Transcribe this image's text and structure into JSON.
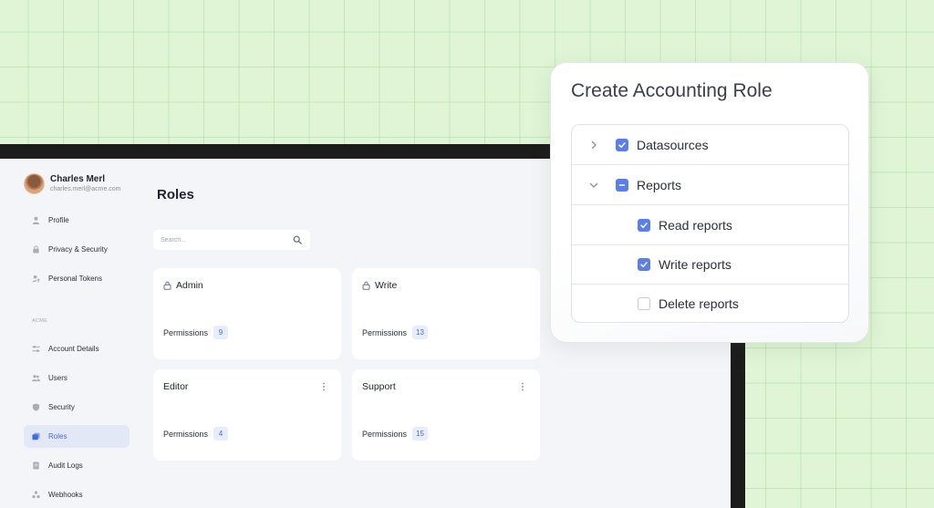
{
  "user": {
    "name": "Charles Merl",
    "email": "charles.merl@acme.com"
  },
  "sidebar": {
    "items": [
      {
        "label": "Profile",
        "icon": "user-icon"
      },
      {
        "label": "Privacy & Security",
        "icon": "lock-icon"
      },
      {
        "label": "Personal Tokens",
        "icon": "user-key-icon"
      }
    ],
    "section_label": "ACME",
    "org_items": [
      {
        "label": "Account Details",
        "icon": "sliders-icon"
      },
      {
        "label": "Users",
        "icon": "users-icon"
      },
      {
        "label": "Security",
        "icon": "shield-icon"
      },
      {
        "label": "Roles",
        "icon": "roles-icon",
        "active": true
      },
      {
        "label": "Audit Logs",
        "icon": "document-icon"
      },
      {
        "label": "Webhooks",
        "icon": "webhook-icon"
      }
    ]
  },
  "main": {
    "title": "Roles",
    "search_placeholder": "Search...",
    "roles": [
      {
        "name": "Admin",
        "locked": true,
        "permissions_label": "Permissions",
        "count": "9"
      },
      {
        "name": "Write",
        "locked": true,
        "permissions_label": "Permissions",
        "count": "13"
      },
      {
        "name": "Editor",
        "locked": false,
        "permissions_label": "Permissions",
        "count": "4"
      },
      {
        "name": "Support",
        "locked": false,
        "permissions_label": "Permissions",
        "count": "15"
      }
    ]
  },
  "modal": {
    "title": "Create Accounting Role",
    "tree": [
      {
        "label": "Datasources",
        "state": "checked",
        "expander": "collapsed"
      },
      {
        "label": "Reports",
        "state": "mixed",
        "expander": "expanded"
      },
      {
        "label": "Read reports",
        "state": "checked"
      },
      {
        "label": "Write reports",
        "state": "checked"
      },
      {
        "label": "Delete reports",
        "state": "unchecked"
      }
    ]
  },
  "colors": {
    "accent": "#3e6be8",
    "checkbox": "#5b7fe8",
    "background_green": "#dff5d6"
  }
}
